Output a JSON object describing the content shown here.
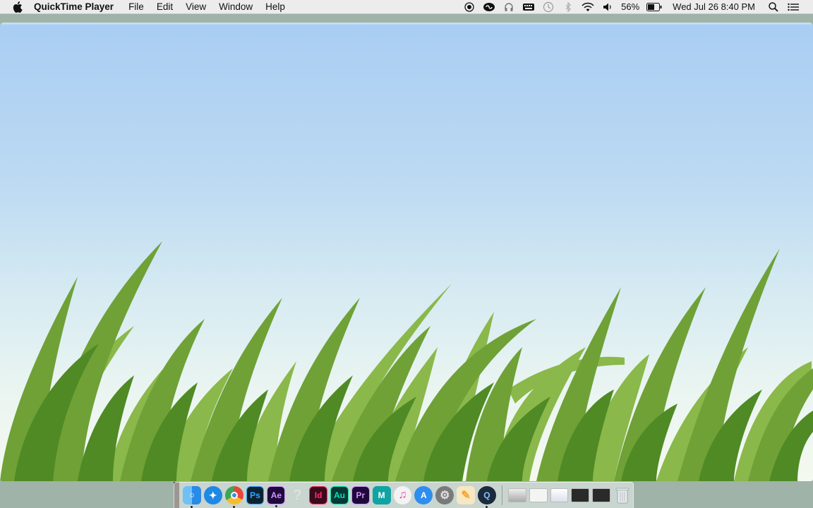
{
  "menubar": {
    "app_name": "QuickTime Player",
    "menus": [
      "File",
      "Edit",
      "View",
      "Window",
      "Help"
    ],
    "battery_percent": "56%",
    "datetime": "Wed Jul 26  8:40 PM"
  },
  "window": {
    "content": "video-frame"
  },
  "dock": {
    "apps": [
      {
        "name": "finder",
        "label": "",
        "color": "#2a8ae8",
        "running": true
      },
      {
        "name": "safari",
        "label": "",
        "color": "#1e88e5",
        "running": false
      },
      {
        "name": "chrome",
        "label": "",
        "color": "#e8453c",
        "running": true
      },
      {
        "name": "photoshop",
        "label": "Ps",
        "color": "#0b2233",
        "text_color": "#31a8ff",
        "running": false
      },
      {
        "name": "after-effects",
        "label": "Ae",
        "color": "#1e0a3a",
        "text_color": "#d291ff",
        "running": true
      },
      {
        "name": "help",
        "label": "?",
        "color": "#c8cbc9",
        "text_color": "#e8e8e8",
        "running": false
      },
      {
        "name": "indesign",
        "label": "Id",
        "color": "#3a0a1e",
        "text_color": "#ff3366",
        "running": false
      },
      {
        "name": "audition",
        "label": "Au",
        "color": "#053833",
        "text_color": "#00e4bb",
        "running": false
      },
      {
        "name": "premiere",
        "label": "Pr",
        "color": "#1e0a3a",
        "text_color": "#d291ff",
        "running": false
      },
      {
        "name": "maya",
        "label": "M",
        "color": "#0fa3a3",
        "text_color": "#ffffff",
        "running": false
      },
      {
        "name": "itunes",
        "label": "♫",
        "color": "#f3f3f3",
        "text_color": "#e84aa0",
        "running": false
      },
      {
        "name": "app-store",
        "label": "A",
        "color": "#2d8ef0",
        "text_color": "#ffffff",
        "running": false
      },
      {
        "name": "system-preferences",
        "label": "⚙",
        "color": "#7a7a7a",
        "text_color": "#e0e0e0",
        "running": false
      },
      {
        "name": "sketch-app",
        "label": "",
        "color": "#f3a634",
        "running": false
      },
      {
        "name": "quicktime",
        "label": "Q",
        "color": "#1c2a3c",
        "text_color": "#7fc4ff",
        "running": true
      }
    ],
    "minimized_count": 5,
    "trash": "trash"
  }
}
